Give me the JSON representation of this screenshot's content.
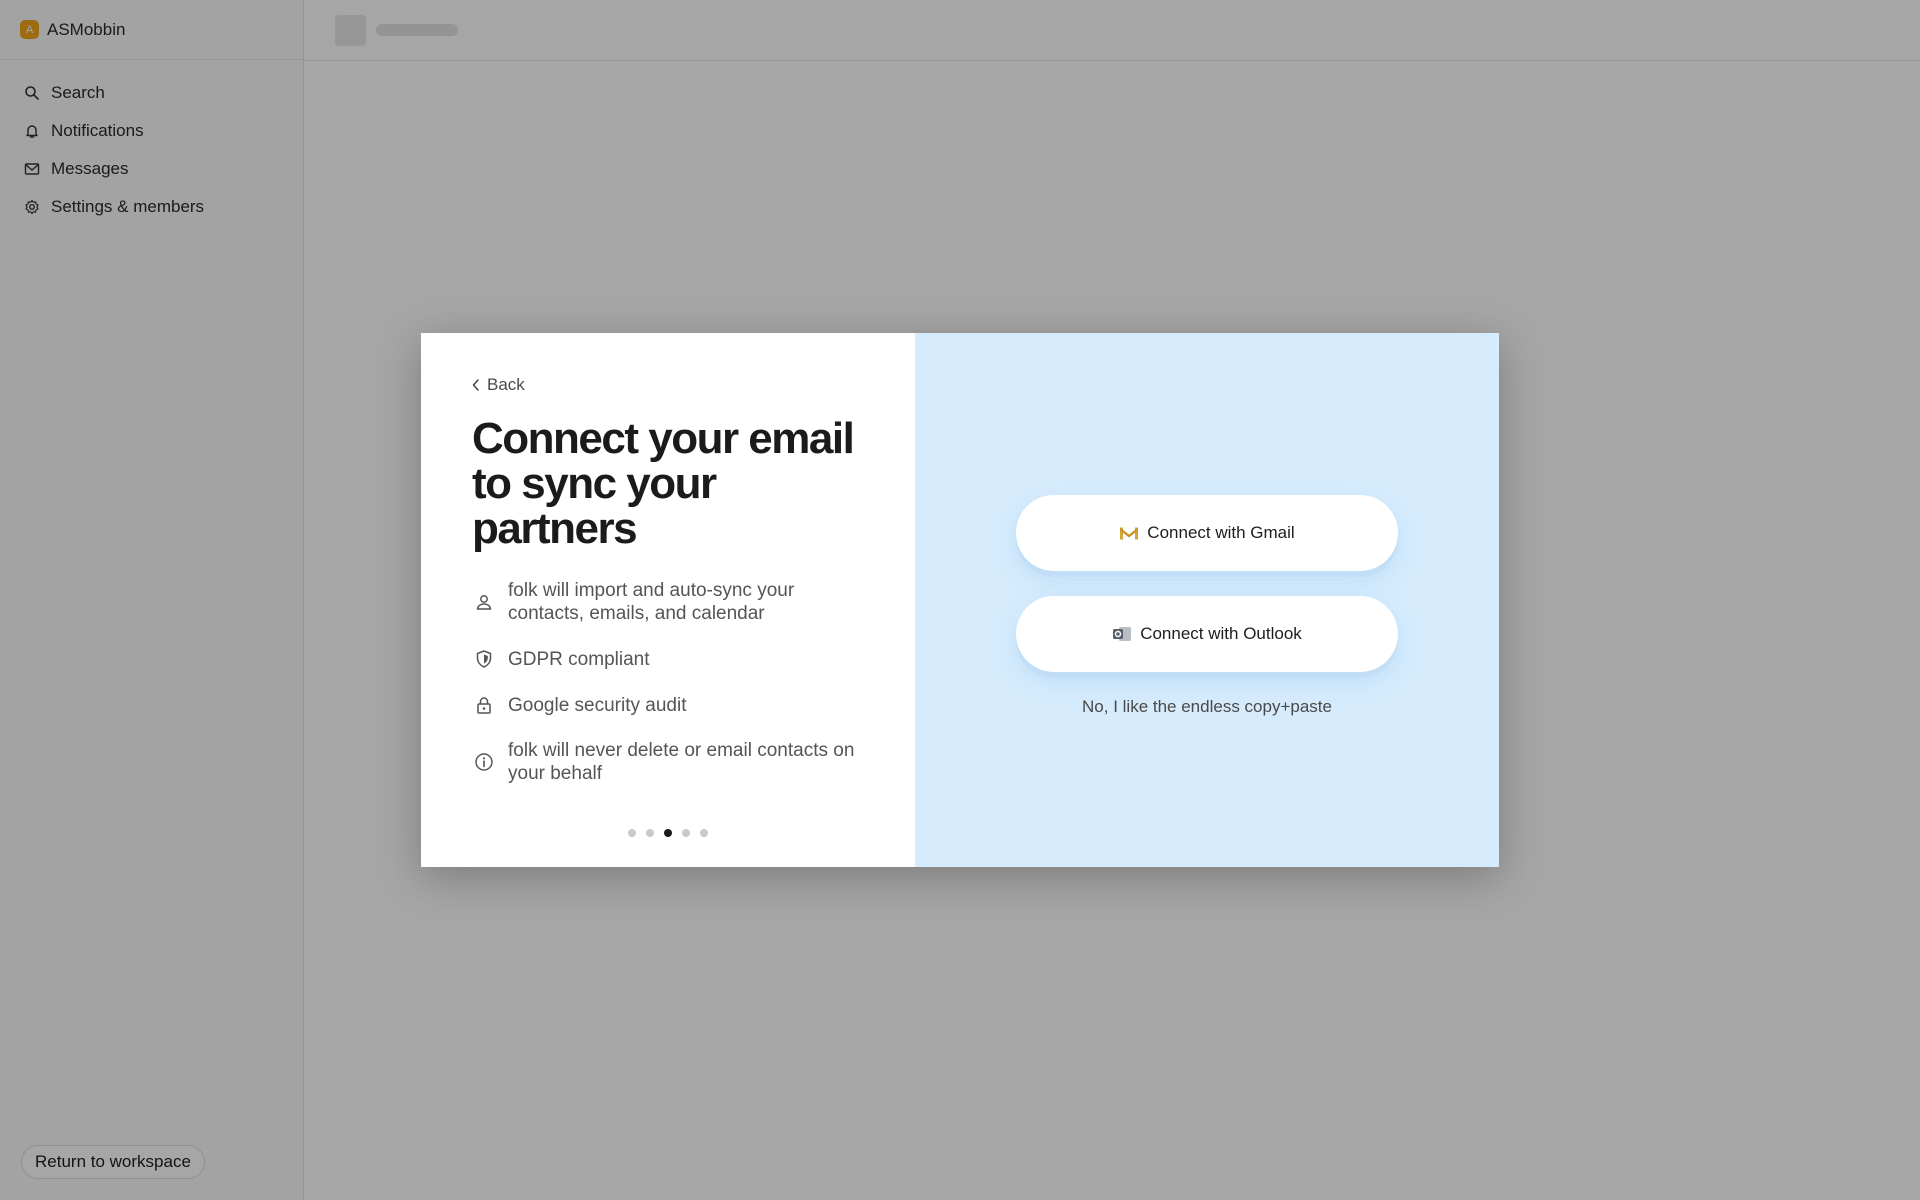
{
  "workspace": {
    "avatar_letter": "A",
    "name": "ASMobbin",
    "accent": "#f2a71b"
  },
  "sidebar": {
    "items": [
      {
        "label": "Search",
        "icon": "search-icon"
      },
      {
        "label": "Notifications",
        "icon": "bell-icon"
      },
      {
        "label": "Messages",
        "icon": "mail-icon"
      },
      {
        "label": "Settings & members",
        "icon": "gear-icon"
      }
    ],
    "return_label": "Return to workspace"
  },
  "modal": {
    "back_label": "Back",
    "headline": "Connect your email to sync your partners",
    "features": [
      {
        "icon": "person-icon",
        "text": "folk will import and auto-sync your contacts, emails, and calendar"
      },
      {
        "icon": "shield-icon",
        "text": "GDPR compliant"
      },
      {
        "icon": "lock-icon",
        "text": "Google security audit"
      },
      {
        "icon": "info-icon",
        "text": "folk will never delete or email contacts on your behalf"
      }
    ],
    "steps": {
      "total": 5,
      "current": 3
    },
    "gmail_label": "Connect with Gmail",
    "outlook_label": "Connect with Outlook",
    "skip_label": "No, I like the endless copy+paste",
    "panel_color": "#d6ecfd"
  }
}
